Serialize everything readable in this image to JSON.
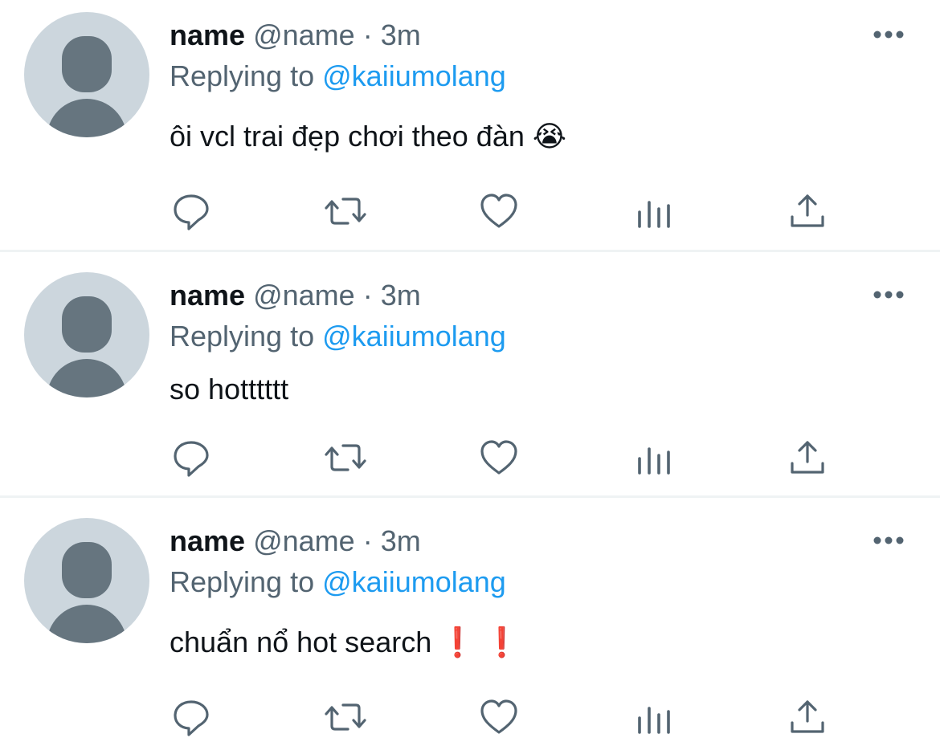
{
  "tweets": [
    {
      "name": "name",
      "handle": "@name",
      "dot": "·",
      "time": "3m",
      "replying_label": "Replying to",
      "replying_handle": "@kaiiumolang",
      "text": "ôi vcl trai đẹp chơi theo đàn",
      "emoji": "😭"
    },
    {
      "name": "name",
      "handle": "@name",
      "dot": "·",
      "time": "3m",
      "replying_label": "Replying to",
      "replying_handle": "@kaiiumolang",
      "text": "so hotttttt"
    },
    {
      "name": "name",
      "handle": "@name",
      "dot": "·",
      "time": "3m",
      "replying_label": "Replying to",
      "replying_handle": "@kaiiumolang",
      "text": "chuẩn nổ hot search",
      "emoji": "❗ ❗"
    }
  ],
  "icons": {
    "more": "more-icon",
    "reply": "reply-icon",
    "retweet": "retweet-icon",
    "like": "like-icon",
    "views": "views-icon",
    "share": "share-icon"
  },
  "colors": {
    "name": "#0f1419",
    "secondary": "#536471",
    "link": "#1d9bf0",
    "avatar_bg": "#ccd6dd",
    "avatar_fg": "#66757f",
    "divider": "#eff3f4"
  }
}
